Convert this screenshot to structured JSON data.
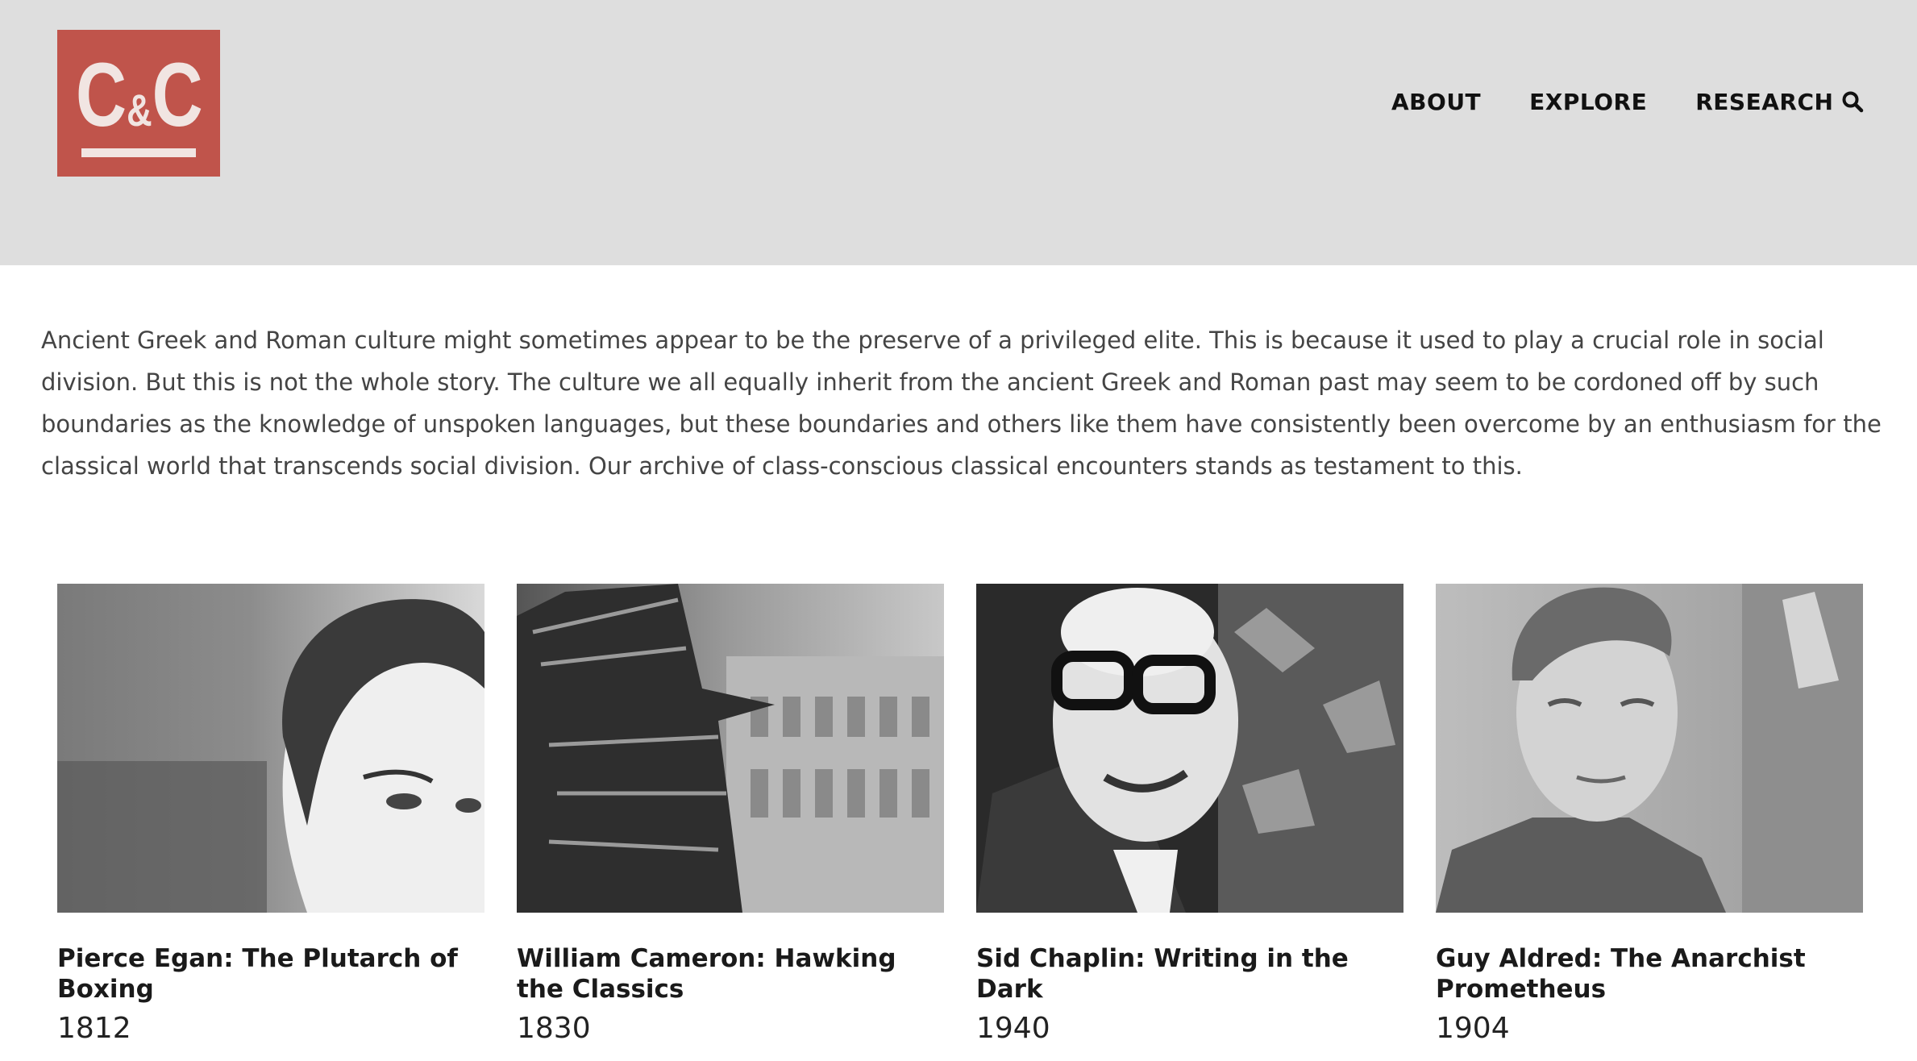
{
  "header": {
    "logo": {
      "left": "C",
      "amp": "&",
      "right": "C",
      "color": "#c0544b"
    },
    "nav": [
      "ABOUT",
      "EXPLORE",
      "RESEARCH"
    ],
    "search_icon": "search-icon"
  },
  "intro": "Ancient Greek and Roman culture might sometimes appear to be the preserve of a privileged elite. This is because it used to play a crucial role in social division. But this is not the whole story. The culture we all equally inherit from the ancient Greek and Roman past may seem to be cordoned off by such boundaries as the knowledge of unspoken languages, but these boundaries and others like them have consistently been overcome by an enthusiasm for the classical world that transcends social division. Our archive of class-conscious classical encounters stands as testament to this.",
  "cards": [
    {
      "title": "Pierce Egan: The Plutarch of Boxing",
      "year": "1812"
    },
    {
      "title": "William Cameron: Hawking the Classics",
      "year": "1830"
    },
    {
      "title": "Sid Chaplin: Writing in the Dark",
      "year": "1940"
    },
    {
      "title": "Guy Aldred: The Anarchist Prometheus",
      "year": "1904"
    }
  ]
}
